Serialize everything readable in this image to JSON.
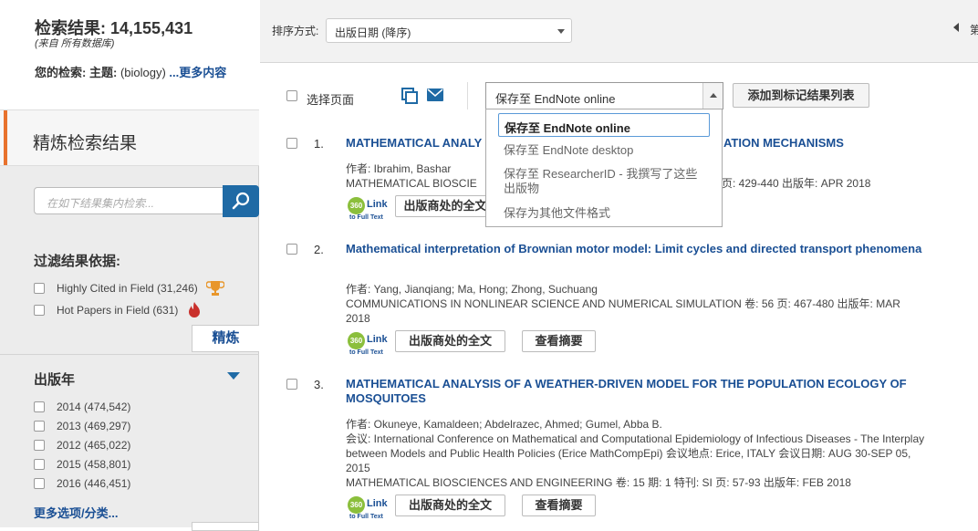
{
  "summary": {
    "title_prefix": "检索结果:",
    "count": "14,155,431",
    "source": "(来自 所有数据库)",
    "your_search_label": "您的检索:",
    "topic_label": "主题:",
    "query": "(biology)",
    "more_link": "...更多内容"
  },
  "refine": {
    "title": "精炼检索结果",
    "search_placeholder": "在如下结果集内检索...",
    "filter_title": "过滤结果依据:",
    "filters": [
      {
        "label": "Highly Cited in Field (31,246)",
        "icon": "trophy-icon"
      },
      {
        "label": "Hot Papers in Field (631)",
        "icon": "flame-icon"
      }
    ],
    "refine_button": "精炼"
  },
  "year_facet": {
    "title": "出版年",
    "items": [
      "2014 (474,542)",
      "2013 (469,297)",
      "2012 (465,022)",
      "2015 (458,801)",
      "2016 (446,451)"
    ],
    "more": "更多选项/分类..."
  },
  "sort": {
    "label": "排序方式:",
    "value": "出版日期 (降序)",
    "page_next_fragment": "第"
  },
  "toolbar": {
    "select_page": "选择页面",
    "save_value": "保存至 EndNote online",
    "add_marked": "添加到标记结果列表"
  },
  "dropdown": {
    "selected": "保存至 EndNote online",
    "items": [
      "保存至 EndNote desktop",
      "保存至 ResearcherID - 我撰写了这些",
      "出版物",
      "保存为其他文件格式"
    ]
  },
  "results": [
    {
      "num": "1.",
      "title_a": "MATHEMATICAL ANALY",
      "title_b": "ATION MECHANISMS",
      "author": "作者: Ibrahim, Bashar",
      "source_a": "MATHEMATICAL BIOSCIE",
      "source_b": "页: 429-440   出版年: APR 2018",
      "link_label": "Link",
      "link_sub": "to Full Text",
      "fulltext_btn": "出版商处的全文"
    },
    {
      "num": "2.",
      "title": "Mathematical interpretation of Brownian motor model: Limit cycles and directed transport phenomena",
      "author": "作者: Yang, Jianqiang; Ma, Hong; Zhong, Suchuang",
      "source": "COMMUNICATIONS IN NONLINEAR SCIENCE AND NUMERICAL SIMULATION  卷: 56   页: 467-480   出版年: MAR",
      "source2": "2018",
      "link_label": "Link",
      "link_sub": "to Full Text",
      "fulltext_btn": "出版商处的全文",
      "abstract_btn": "查看摘要"
    },
    {
      "num": "3.",
      "title": "MATHEMATICAL ANALYSIS OF A WEATHER-DRIVEN MODEL FOR THE POPULATION ECOLOGY OF MOSQUITOES",
      "author": "作者: Okuneye, Kamaldeen; Abdelrazec, Ahmed; Gumel, Abba B.",
      "conf1": "会议: International Conference on Mathematical and Computational Epidemiology of Infectious Diseases - The Interplay",
      "conf2": "between Models and Public Health Policies (Erice MathCompEpi) 会议地点: Erice, ITALY 会议日期: AUG 30-SEP 05,",
      "conf3": "2015",
      "source": "MATHEMATICAL BIOSCIENCES AND ENGINEERING  卷: 15   期: 1   特刊: SI   页: 57-93   出版年: FEB 2018",
      "link_label": "Link",
      "link_sub": "to Full Text",
      "fulltext_btn": "出版商处的全文",
      "abstract_btn": "查看摘要"
    }
  ],
  "colors": {
    "link_blue": "#1a4f94",
    "accent_orange": "#e8722d",
    "search_btn": "#1f6aa5",
    "link360_green": "#8bbf3c"
  }
}
